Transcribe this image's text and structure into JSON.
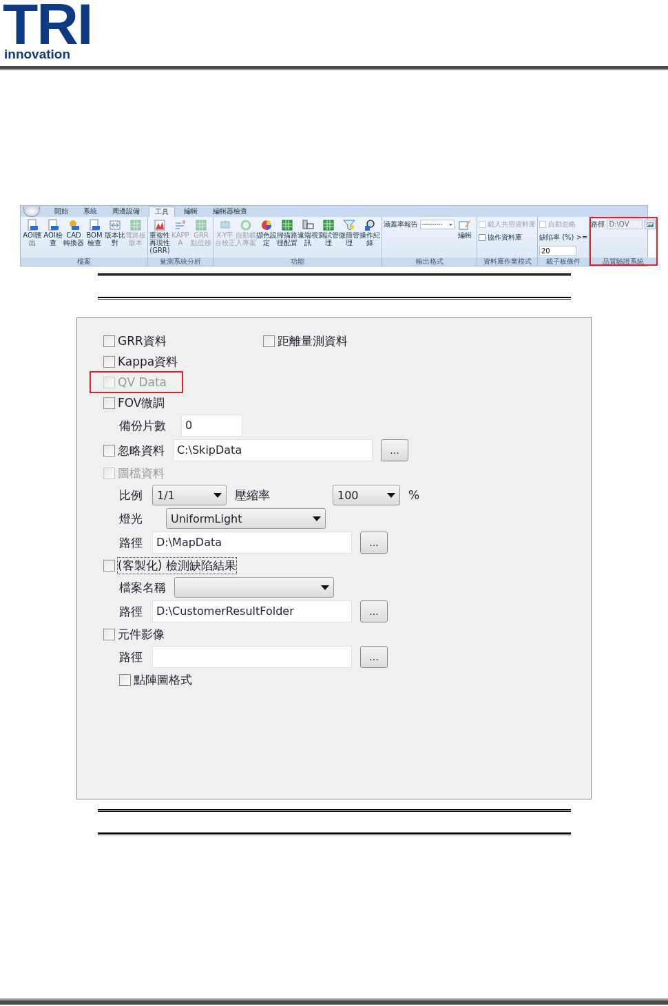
{
  "header": {
    "logo": "TRI",
    "tagline": "innovation"
  },
  "ribbon": {
    "tabs": [
      {
        "label": "開始",
        "selected": false
      },
      {
        "label": "系統",
        "selected": false
      },
      {
        "label": "周邊設備",
        "selected": false
      },
      {
        "label": "工具",
        "selected": true
      },
      {
        "label": "編輯",
        "selected": false
      },
      {
        "label": "編輯器檢查",
        "selected": false
      }
    ],
    "groups": [
      {
        "title": "檔案",
        "highlighted": false,
        "items": [
          {
            "kind": "button",
            "label": "AOI匯出",
            "disabled": false
          },
          {
            "kind": "button",
            "label": "AOI檢查",
            "disabled": false
          },
          {
            "kind": "button",
            "label": "CAD轉換器",
            "disabled": false
          },
          {
            "kind": "button",
            "label": "BOM檢查",
            "disabled": false
          },
          {
            "kind": "button",
            "label": "版本比對",
            "disabled": false
          },
          {
            "kind": "button",
            "label": "電路板版本",
            "disabled": true
          }
        ]
      },
      {
        "title": "量測系統分析",
        "highlighted": false,
        "items": [
          {
            "kind": "button",
            "label": "重複性再現性(GRR)",
            "disabled": false
          },
          {
            "kind": "button",
            "label": "KAPPA",
            "disabled": true
          },
          {
            "kind": "button",
            "label": "GRR點位移",
            "disabled": true
          }
        ]
      },
      {
        "title": "功能",
        "highlighted": false,
        "items": [
          {
            "kind": "button",
            "label": "X-Y平台校正",
            "disabled": true
          },
          {
            "kind": "button",
            "label": "自動載入專案",
            "disabled": true
          },
          {
            "kind": "button",
            "label": "擷色設定",
            "disabled": false
          },
          {
            "kind": "button",
            "label": "掃描路徑配置",
            "disabled": false
          },
          {
            "kind": "button",
            "label": "遠端視訊",
            "disabled": false
          },
          {
            "kind": "button",
            "label": "測試管理",
            "disabled": false
          },
          {
            "kind": "button",
            "label": "微篩管理",
            "disabled": false
          },
          {
            "kind": "button",
            "label": "操作紀錄",
            "disabled": false
          }
        ]
      },
      {
        "title": "輸出格式",
        "highlighted": false,
        "items": [
          {
            "kind": "dropdown",
            "label": "涵蓋率報告"
          },
          {
            "kind": "button",
            "label": "編輯",
            "disabled": false
          }
        ]
      },
      {
        "title": "資料庫作業模式",
        "highlighted": false,
        "items": [
          {
            "kind": "checkbox",
            "label": "載入共用資料庫",
            "checked": false,
            "disabled": true
          },
          {
            "kind": "checkbox",
            "label": "協作資料庫",
            "checked": false,
            "disabled": false
          }
        ]
      },
      {
        "title": "載子板條件",
        "highlighted": false,
        "items": [
          {
            "kind": "checkbox",
            "label": "自動忽略",
            "checked": false,
            "disabled": true
          },
          {
            "kind": "input",
            "label": "缺陷率 (%) >=",
            "value": "20"
          }
        ]
      },
      {
        "title": "品質驗證系統",
        "highlighted": true,
        "items": [
          {
            "kind": "path",
            "label": "路徑",
            "value": "D:\\QV"
          }
        ]
      }
    ]
  },
  "dialog": {
    "rows": [
      {
        "kind": "checks",
        "items": [
          {
            "label": "GRR資料",
            "checked": false,
            "disabled": false
          },
          {
            "label": "距離量測資料",
            "checked": false,
            "disabled": false
          }
        ]
      },
      {
        "kind": "checks",
        "items": [
          {
            "label": "Kappa資料",
            "checked": false,
            "disabled": false
          }
        ]
      },
      {
        "kind": "checks",
        "items": [
          {
            "label": "QV Data",
            "checked": false,
            "disabled": true,
            "highlighted": true
          }
        ]
      },
      {
        "kind": "checks",
        "items": [
          {
            "label": "FOV微調",
            "checked": false,
            "disabled": false
          }
        ],
        "children": [
          {
            "kind": "text",
            "label": "備份片數",
            "value": "0"
          }
        ]
      },
      {
        "kind": "check_path",
        "label": "忽略資料",
        "checked": false,
        "disabled": false,
        "value": "C:\\SkipData",
        "button": "..."
      },
      {
        "kind": "checks",
        "items": [
          {
            "label": "圖檔資料",
            "checked": false,
            "disabled": true
          }
        ],
        "children": [
          {
            "kind": "selects",
            "items": [
              {
                "label": "比例",
                "value": "1/1"
              },
              {
                "label": "壓縮率",
                "value": "100",
                "unit": "%"
              }
            ]
          },
          {
            "kind": "selects",
            "items": [
              {
                "label": "燈光",
                "value": "UniformLight"
              }
            ]
          },
          {
            "kind": "path",
            "label": "路徑",
            "value": "D:\\MapData",
            "button": "..."
          }
        ]
      },
      {
        "kind": "checks",
        "items": [
          {
            "label": "(客製化) 檢測缺陷結果",
            "checked": false,
            "disabled": false,
            "focused": true
          }
        ],
        "children": [
          {
            "kind": "selects",
            "items": [
              {
                "label": "檔案名稱"
              }
            ]
          },
          {
            "kind": "path",
            "label": "路徑",
            "value": "D:\\CustomerResultFolder",
            "button": "..."
          }
        ]
      },
      {
        "kind": "checks",
        "items": [
          {
            "label": "元件影像",
            "checked": false,
            "disabled": false
          }
        ],
        "children": [
          {
            "kind": "path",
            "label": "路徑",
            "button": "..."
          },
          {
            "kind": "checks",
            "items": [
              {
                "label": "點陣圖格式",
                "checked": false,
                "disabled": false
              }
            ]
          }
        ]
      }
    ]
  }
}
